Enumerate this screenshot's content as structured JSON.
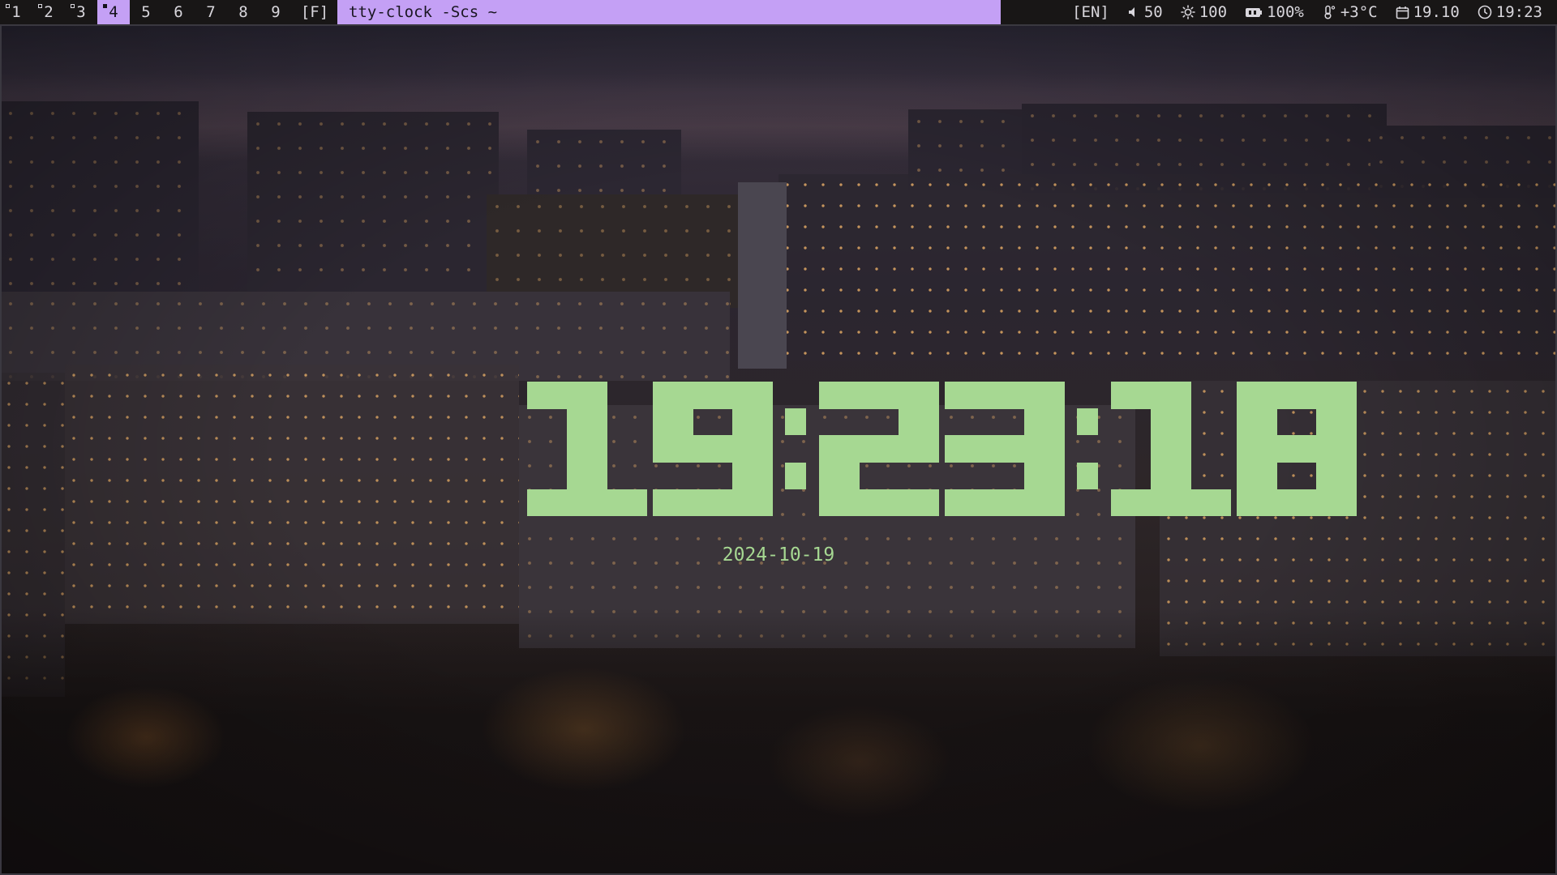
{
  "bar": {
    "workspaces": [
      {
        "label": "1",
        "occupied": true,
        "active": false
      },
      {
        "label": "2",
        "occupied": true,
        "active": false
      },
      {
        "label": "3",
        "occupied": true,
        "active": false
      },
      {
        "label": "4",
        "occupied": true,
        "active": true
      },
      {
        "label": "5",
        "occupied": false,
        "active": false
      },
      {
        "label": "6",
        "occupied": false,
        "active": false
      },
      {
        "label": "7",
        "occupied": false,
        "active": false
      },
      {
        "label": "8",
        "occupied": false,
        "active": false
      },
      {
        "label": "9",
        "occupied": false,
        "active": false
      }
    ],
    "layout": "[F]",
    "window_title": "tty-clock -Scs ~",
    "keyboard": "[EN]",
    "volume": "50",
    "brightness": "100",
    "battery": "100%",
    "temperature": "+3°C",
    "date": "19.10",
    "time": "19:23",
    "accent_color": "#c4a0f5",
    "icons": {
      "volume": "speaker-icon",
      "brightness": "sun-icon",
      "battery": "battery-icon",
      "temperature": "thermometer-icon",
      "date": "calendar-icon",
      "time": "clock-icon"
    }
  },
  "clock": {
    "time": "19:23:18",
    "date": "2024-10-19",
    "color": "#a6d892"
  }
}
